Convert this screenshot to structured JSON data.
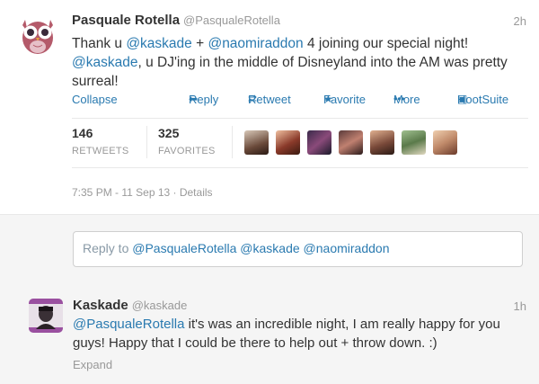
{
  "tweet": {
    "name": "Pasquale Rotella",
    "handle": "@PasqualeRotella",
    "time": "2h",
    "text_parts": {
      "p1": "Thank u ",
      "m1": "@kaskade",
      "p2": " + ",
      "m2": "@naomiraddon",
      "p3": " 4 joining our special night! ",
      "m3": "@kaskade",
      "p4": ", u DJ'ing in the middle of Disneyland into the AM was pretty surreal!"
    },
    "actions": {
      "collapse": "Collapse",
      "reply": "Reply",
      "retweet": "Retweet",
      "favorite": "Favorite",
      "more": "More",
      "hootsuite": "HootSuite"
    },
    "stats": {
      "retweets_count": "146",
      "retweets_label": "RETWEETS",
      "favorites_count": "325",
      "favorites_label": "FAVORITES"
    },
    "date": "7:35 PM - 11 Sep 13 · Details"
  },
  "reply_box": {
    "prefix": "Reply to ",
    "mentions": "@PasqualeRotella @kaskade @naomiraddon"
  },
  "reply_tweet": {
    "name": "Kaskade",
    "handle": "@kaskade",
    "time": "1h",
    "mention": "@PasqualeRotella",
    "text": " it's was an incredible night, I am really happy for you guys!  Happy that I could be there to help out + throw down.  :)",
    "expand": "Expand"
  },
  "colors": {
    "link": "#2a7ab0",
    "muted": "#999999",
    "reply_bg": "#f5f5f5"
  },
  "icons": {
    "reply": "reply-arrow-icon",
    "retweet": "retweet-icon",
    "favorite": "star-icon",
    "more": "more-dots-icon",
    "hootsuite": "hootsuite-owl-icon"
  }
}
